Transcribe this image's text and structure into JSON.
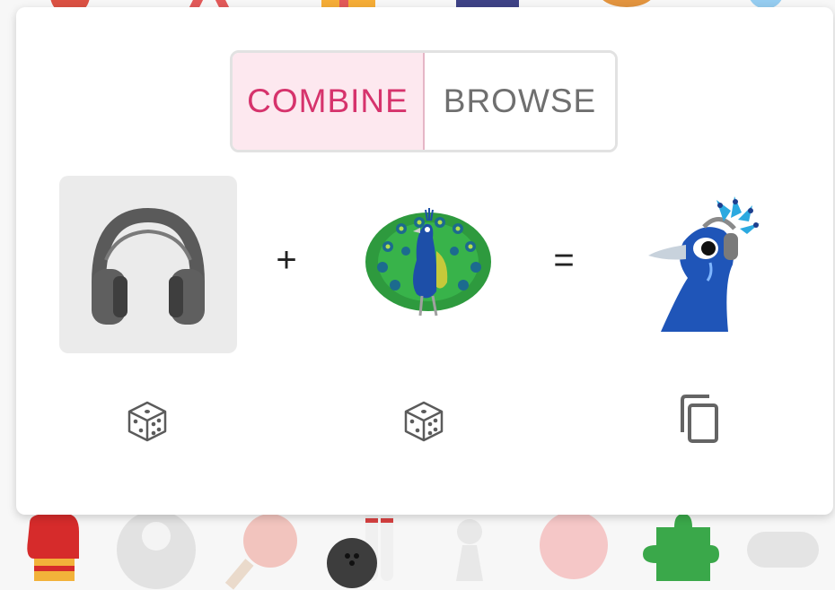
{
  "tabs": {
    "combine_label": "COMBINE",
    "browse_label": "BROWSE",
    "active": "combine"
  },
  "operators": {
    "plus": "+",
    "equals": "="
  },
  "slots": [
    {
      "icon": "headphone-emoji-icon",
      "selected": true
    },
    {
      "icon": "peacock-emoji-icon",
      "selected": false
    },
    {
      "icon": "headphone-peacock-mashup-icon",
      "selected": false
    }
  ],
  "actions": {
    "left_random_icon": "dice-icon",
    "right_random_icon": "dice-icon",
    "copy_icon": "copy-icon"
  },
  "colors": {
    "accent": "#d6336c",
    "accent_bg": "#fde8ef",
    "inactive_text": "#6f6f6f"
  }
}
